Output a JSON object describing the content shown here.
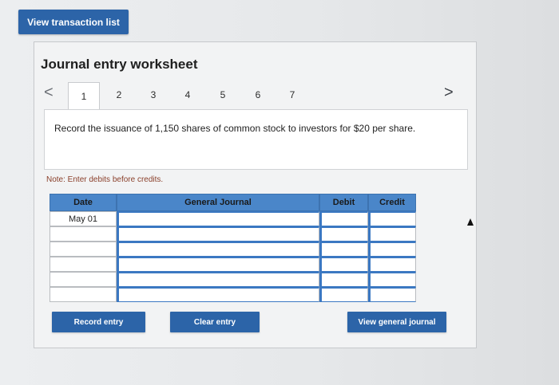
{
  "header": {
    "view_transactions_label": "View transaction list"
  },
  "worksheet": {
    "title": "Journal entry worksheet",
    "pager": {
      "prev": "<",
      "next": ">",
      "tabs": [
        "1",
        "2",
        "3",
        "4",
        "5",
        "6",
        "7"
      ],
      "active_tab": "1"
    },
    "instruction": "Record the issuance of 1,150 shares of common stock to investors for $20 per share.",
    "note": "Note: Enter debits before credits.",
    "table": {
      "columns": [
        "Date",
        "General Journal",
        "Debit",
        "Credit"
      ],
      "rows": [
        [
          "May 01",
          "",
          "",
          ""
        ],
        [
          "",
          "",
          "",
          ""
        ],
        [
          "",
          "",
          "",
          ""
        ],
        [
          "",
          "",
          "",
          ""
        ],
        [
          "",
          "",
          "",
          ""
        ],
        [
          "",
          "",
          "",
          ""
        ]
      ]
    },
    "buttons": {
      "record": "Record entry",
      "clear": "Clear entry",
      "view_journal": "View general journal"
    }
  },
  "colors": {
    "accent": "#2c64a8",
    "header_fill": "#4a86c9"
  }
}
